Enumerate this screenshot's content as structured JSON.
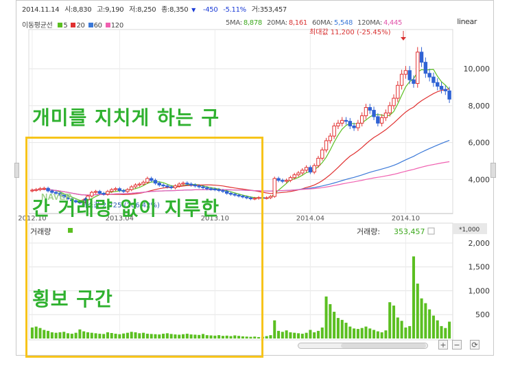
{
  "info_bar": {
    "date": "2014.11.14",
    "open": "시:8,830",
    "high": "고:9,190",
    "low": "저:8,250",
    "close": "종:8,350",
    "change_arrow": "▼",
    "change": "-450",
    "change_pct": "-5.11%",
    "volume": "거:353,457"
  },
  "price_legend": {
    "label": "이동평균선",
    "items": [
      {
        "label": "5",
        "color": "#5bbf21"
      },
      {
        "label": "20",
        "color": "#e03030"
      },
      {
        "label": "60",
        "color": "#3a78d8"
      },
      {
        "label": "120",
        "color": "#f060b0"
      }
    ]
  },
  "ma_values": [
    {
      "label": "5MA:",
      "value": "8,878",
      "color": "#3aa81a"
    },
    {
      "label": "20MA:",
      "value": "8,161",
      "color": "#d83030"
    },
    {
      "label": "60MA:",
      "value": "5,548",
      "color": "#3a78d8"
    },
    {
      "label": "120MA:",
      "value": "4,445",
      "color": "#e050a8"
    }
  ],
  "scale_type": "linear",
  "max_annotation": "최대값 11,200 (-25.45%)",
  "min_annotation": "최소값 2,725 (206.42%)",
  "watermark": "NAVER",
  "volume_panel": {
    "title": "거래량",
    "legend_label": "거래량:",
    "legend_value": "353,457",
    "multiplier": "*1,000",
    "color": "#5bbf21"
  },
  "overlay_note": {
    "lines": [
      "개미를 지치게 하는 구",
      "간 거래량 없이 지루한",
      "횡보 구간"
    ],
    "color": "#2fb12f"
  },
  "highlight_color": "#f7c41a",
  "zoom_in": "+",
  "zoom_out": "−",
  "reset": "⟳",
  "chart_data": {
    "type": "line",
    "price_axis": {
      "ticks": [
        "4,000",
        "6,000",
        "8,000",
        "10,000"
      ],
      "values": [
        4000,
        6000,
        8000,
        10000
      ],
      "ylim": [
        2450,
        11900
      ]
    },
    "volume_axis": {
      "ticks": [
        "500",
        "1,000",
        "1,500",
        "2,000"
      ],
      "values": [
        500,
        1000,
        1500,
        2000
      ],
      "ylim": [
        0,
        2100
      ]
    },
    "x_ticks": [
      "2012.10",
      "2013.04",
      "2013.10",
      "2014.04",
      "2014.10"
    ],
    "x_tick_index": [
      0,
      22,
      46,
      70,
      94
    ],
    "n_periods": 106,
    "close": [
      3420,
      3450,
      3500,
      3520,
      3380,
      3300,
      3250,
      3150,
      3050,
      2950,
      2850,
      2780,
      2725,
      2900,
      3100,
      3300,
      3350,
      3250,
      3200,
      3350,
      3450,
      3500,
      3400,
      3350,
      3450,
      3600,
      3700,
      3750,
      3850,
      4050,
      3950,
      3800,
      3700,
      3650,
      3600,
      3550,
      3650,
      3750,
      3800,
      3750,
      3700,
      3650,
      3600,
      3550,
      3500,
      3480,
      3450,
      3400,
      3350,
      3250,
      3200,
      3150,
      3100,
      3050,
      3000,
      2950,
      2980,
      3020,
      2990,
      3010,
      3080,
      4050,
      3950,
      3900,
      3950,
      4100,
      4250,
      4350,
      4500,
      4650,
      4400,
      4750,
      5150,
      5600,
      6100,
      6350,
      6900,
      7050,
      7200,
      7150,
      6900,
      6800,
      7050,
      7450,
      7900,
      7750,
      7400,
      7050,
      7350,
      7600,
      8000,
      8400,
      9100,
      9700,
      9900,
      9400,
      9200,
      10900,
      10350,
      9750,
      9550,
      9250,
      9050,
      8880,
      8800,
      8350
    ],
    "volume": [
      230,
      250,
      220,
      180,
      160,
      130,
      120,
      130,
      140,
      110,
      100,
      120,
      190,
      150,
      130,
      120,
      110,
      100,
      95,
      130,
      115,
      100,
      90,
      105,
      120,
      140,
      130,
      110,
      120,
      100,
      95,
      90,
      85,
      100,
      110,
      95,
      85,
      80,
      90,
      100,
      85,
      80,
      75,
      95,
      70,
      65,
      60,
      70,
      55,
      60,
      50,
      65,
      55,
      45,
      40,
      35,
      40,
      30,
      35,
      50,
      70,
      380,
      160,
      140,
      170,
      130,
      120,
      110,
      100,
      120,
      180,
      130,
      160,
      230,
      880,
      720,
      560,
      430,
      390,
      330,
      250,
      210,
      200,
      220,
      250,
      210,
      180,
      150,
      130,
      170,
      760,
      690,
      440,
      370,
      230,
      260,
      1720,
      1150,
      840,
      740,
      610,
      480,
      380,
      260,
      220,
      353
    ]
  }
}
